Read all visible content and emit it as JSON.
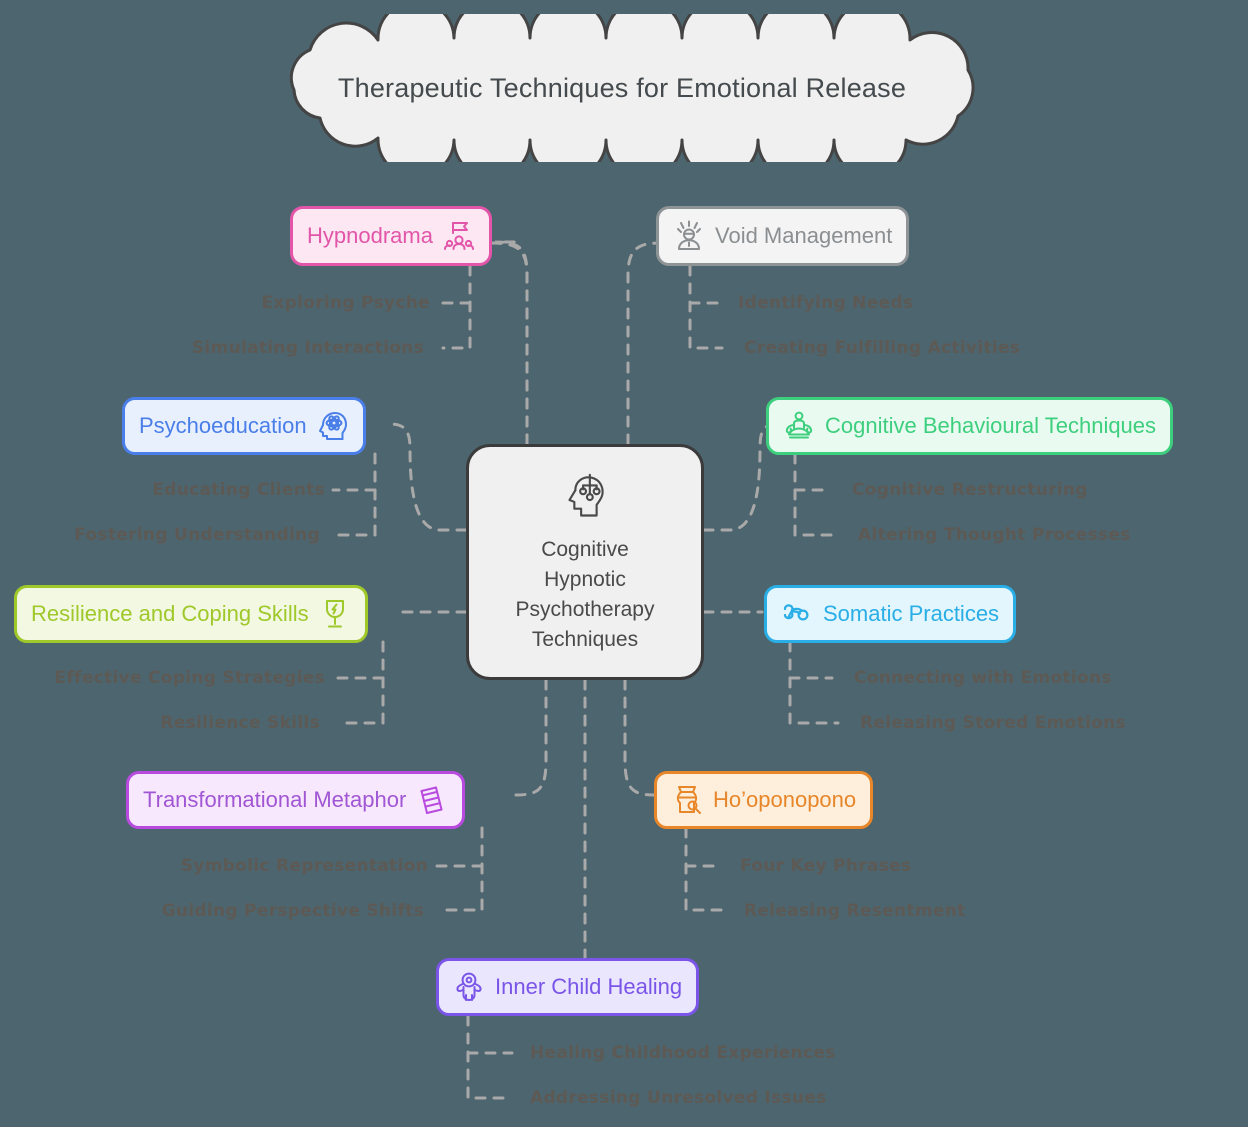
{
  "background_color": "#4d656e",
  "title": {
    "text": "Therapeutic Techniques for Emotional Release",
    "shape": "cloud",
    "fill": "#f0f0f0",
    "stroke": "#444444",
    "text_color": "#444a4d"
  },
  "center": {
    "label": "Cognitive\nHypnotic\nPsychotherapy\nTechniques",
    "line1": "Cognitive",
    "line2": "Hypnotic",
    "line3": "Psychotherapy",
    "line4": "Techniques",
    "icon": "head-circuit-icon",
    "fill": "#f0f0f0",
    "stroke": "#3b3b3b",
    "text_color": "#4a4a4a"
  },
  "branches": [
    {
      "id": "hypnodrama",
      "label": "Hypnodrama",
      "icon": "flag-people-icon",
      "fill": "#fce7f3",
      "stroke": "#e255a8",
      "text_color": "#e255a8",
      "subs": [
        "Exploring Psyche",
        "Simulating Interactions"
      ]
    },
    {
      "id": "void-management",
      "label": "Void Management",
      "icon": "stressed-person-icon",
      "fill": "#f4f4f4",
      "stroke": "#8e9396",
      "text_color": "#8b8f92",
      "subs": [
        "Identifying Needs",
        "Creating Fulfilling Activities"
      ]
    },
    {
      "id": "psychoeducation",
      "label": "Psychoeducation",
      "icon": "head-atom-icon",
      "fill": "#e8f0fe",
      "stroke": "#4a7ee8",
      "text_color": "#4a7ee8",
      "subs": [
        "Educating Clients",
        "Fostering Understanding"
      ]
    },
    {
      "id": "cognitive-behavioural-techniques",
      "label": "Cognitive Behavioural Techniques",
      "icon": "meditating-person-icon",
      "fill": "#e9fbf0",
      "stroke": "#3ecf7e",
      "text_color": "#3ecf7e",
      "subs": [
        "Cognitive Restructuring",
        "Altering Thought Processes"
      ]
    },
    {
      "id": "resilience-and-coping-skills",
      "label": "Resilience and Coping Skills",
      "icon": "goblet-lightning-icon",
      "fill": "#f3f8e2",
      "stroke": "#9fc82a",
      "text_color": "#9fc82a",
      "subs": [
        "Effective Coping Strategies",
        "Resilience Skills"
      ]
    },
    {
      "id": "somatic-practices",
      "label": "Somatic Practices",
      "icon": "reclining-body-icon",
      "fill": "#e3f5fd",
      "stroke": "#29aee6",
      "text_color": "#29aee6",
      "subs": [
        "Connecting with Emotions",
        "Releasing Stored Emotions"
      ]
    },
    {
      "id": "transformational-metaphor",
      "label": "Transformational Metaphor",
      "icon": "ladder-icon",
      "fill": "#f8e8fd",
      "stroke": "#b84ae0",
      "text_color": "#a157d4",
      "subs": [
        "Symbolic Representation",
        "Guiding Perspective Shifts"
      ]
    },
    {
      "id": "hooponopono",
      "label": "Ho’oponopono",
      "icon": "vase-icon",
      "fill": "#fdefdc",
      "stroke": "#e8862a",
      "text_color": "#e8862a",
      "subs": [
        "Four Key Phrases",
        "Releasing Resentment"
      ]
    },
    {
      "id": "inner-child-healing",
      "label": "Inner Child Healing",
      "icon": "child-icon",
      "fill": "#eae6fd",
      "stroke": "#7a55e8",
      "text_color": "#7a55e8",
      "subs": [
        "Healing Childhood Experiences",
        "Addressing Unresolved Issues"
      ]
    }
  ],
  "connector": {
    "color": "#a9a9a9",
    "style": "dashed"
  }
}
